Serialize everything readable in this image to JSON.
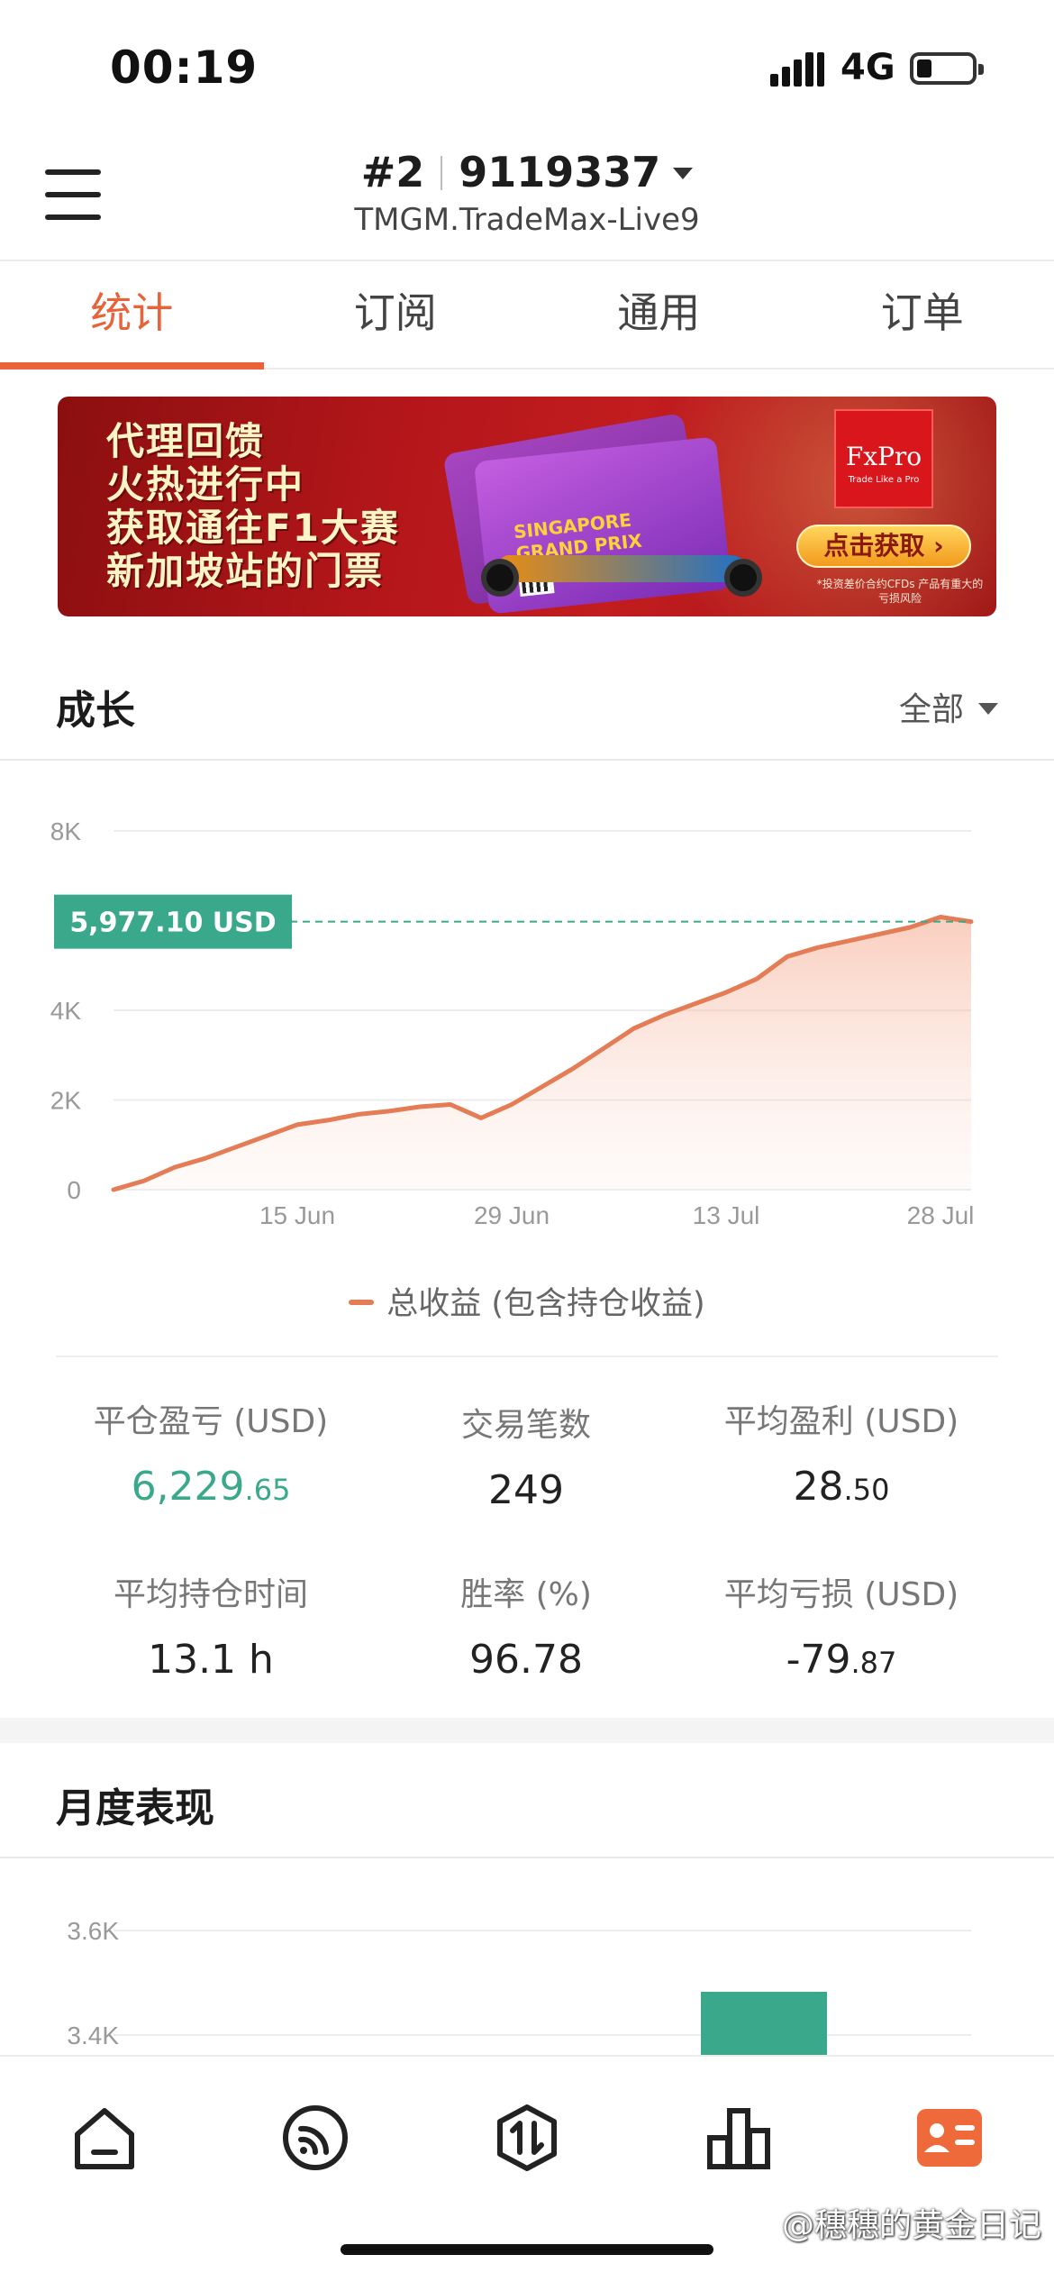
{
  "status_bar": {
    "time": "00:19",
    "network": "4G"
  },
  "header": {
    "account_index": "#2",
    "account_number": "9119337",
    "server": "TMGM.TradeMax-Live9"
  },
  "tabs": [
    {
      "label": "统计",
      "active": true
    },
    {
      "label": "订阅",
      "active": false
    },
    {
      "label": "通用",
      "active": false
    },
    {
      "label": "订单",
      "active": false
    }
  ],
  "banner": {
    "lines": [
      "代理回馈",
      "火热进行中",
      "获取通往F1大赛",
      "新加坡站的门票"
    ],
    "ticket_title": [
      "SINGAPORE",
      "GRAND PRIX"
    ],
    "brand": "FxPro",
    "brand_tagline": "Trade Like a Pro",
    "cta": "点击获取 ›",
    "disclaimer": "*投资差价合约CFDs 产品有重大的亏损风险"
  },
  "growth": {
    "title": "成长",
    "filter": "全部",
    "current_label": "5,977.10 USD",
    "legend": "总收益 (包含持仓收益)"
  },
  "chart_data": [
    {
      "type": "area",
      "title": "成长",
      "series": [
        {
          "name": "总收益 (包含持仓收益)",
          "color": "#e47c55"
        }
      ],
      "x_ticks": [
        "15 Jun",
        "29 Jun",
        "13 Jul",
        "28 Jul"
      ],
      "y_ticks": [
        "0",
        "2K",
        "4K",
        "8K"
      ],
      "ylim": [
        0,
        8000
      ],
      "x": [
        "Jun 03",
        "Jun 05",
        "Jun 07",
        "Jun 09",
        "Jun 11",
        "Jun 13",
        "Jun 15",
        "Jun 17",
        "Jun 19",
        "Jun 21",
        "Jun 23",
        "Jun 25",
        "Jun 27",
        "Jun 29",
        "Jul 01",
        "Jul 03",
        "Jul 05",
        "Jul 07",
        "Jul 09",
        "Jul 11",
        "Jul 13",
        "Jul 15",
        "Jul 17",
        "Jul 19",
        "Jul 21",
        "Jul 23",
        "Jul 25",
        "Jul 27",
        "Jul 29"
      ],
      "values": [
        0,
        200,
        500,
        700,
        950,
        1200,
        1450,
        1550,
        1680,
        1750,
        1850,
        1900,
        1600,
        1900,
        2300,
        2700,
        3150,
        3600,
        3900,
        4150,
        4400,
        4700,
        5200,
        5400,
        5550,
        5700,
        5850,
        6080,
        5977
      ],
      "current_value": 5977.1,
      "current_value_label": "5,977.10 USD"
    },
    {
      "type": "bar",
      "title": "月度表现",
      "y_ticks": [
        "3.6K",
        "3.4K"
      ],
      "ylim": [
        3400,
        3600
      ],
      "bars": [
        {
          "color": "#3aa88a"
        }
      ]
    }
  ],
  "stats": [
    {
      "label": "平仓盈亏 (USD)",
      "int": "6,229",
      "dec": ".65",
      "color": "green"
    },
    {
      "label": "交易笔数",
      "int": "249",
      "dec": "",
      "color": "default"
    },
    {
      "label": "平均盈利 (USD)",
      "int": "28",
      "dec": ".50",
      "color": "default"
    },
    {
      "label": "平均持仓时间",
      "int": "13.1 h",
      "dec": "",
      "color": "default"
    },
    {
      "label": "胜率 (%)",
      "int": "96.78",
      "dec": "",
      "color": "default"
    },
    {
      "label": "平均亏损 (USD)",
      "int": "-79",
      "dec": ".87",
      "color": "default"
    }
  ],
  "monthly": {
    "title": "月度表现"
  },
  "bottom_nav": [
    {
      "icon": "home-icon"
    },
    {
      "icon": "signal-feed-icon"
    },
    {
      "icon": "trade-arrows-icon"
    },
    {
      "icon": "bar-chart-icon"
    },
    {
      "icon": "profile-card-icon",
      "active": true
    }
  ],
  "watermark": "@穗穗的黄金日记",
  "colors": {
    "accent": "#e8623a",
    "green": "#3aa88a",
    "line": "#e47c55"
  }
}
